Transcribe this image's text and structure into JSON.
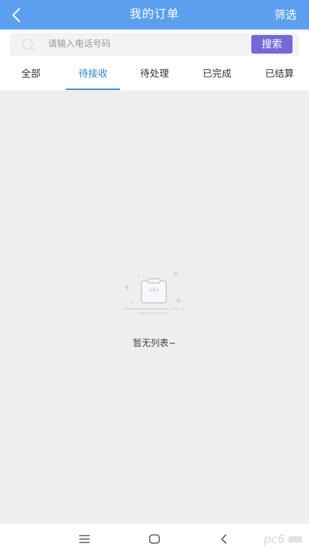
{
  "header": {
    "title": "我的订单",
    "filter_label": "筛选"
  },
  "search": {
    "placeholder": "请输入电话号码",
    "value": "",
    "button_label": "搜索"
  },
  "tabs": [
    {
      "label": "全部",
      "active": false
    },
    {
      "label": "待接收",
      "active": true
    },
    {
      "label": "待处理",
      "active": false
    },
    {
      "label": "已完成",
      "active": false
    },
    {
      "label": "已结算",
      "active": false
    }
  ],
  "empty_state": {
    "text": "暂无列表~",
    "icon": "empty-box-icon"
  },
  "navbar": {
    "icons": [
      "menu-icon",
      "home-icon",
      "back-icon"
    ]
  },
  "watermark": {
    "text": "pc6"
  },
  "colors": {
    "header_bg": "#5aa0ee",
    "accent_tab": "#2f88d0",
    "search_button": "#7468d8",
    "content_bg": "#eeeeee"
  }
}
